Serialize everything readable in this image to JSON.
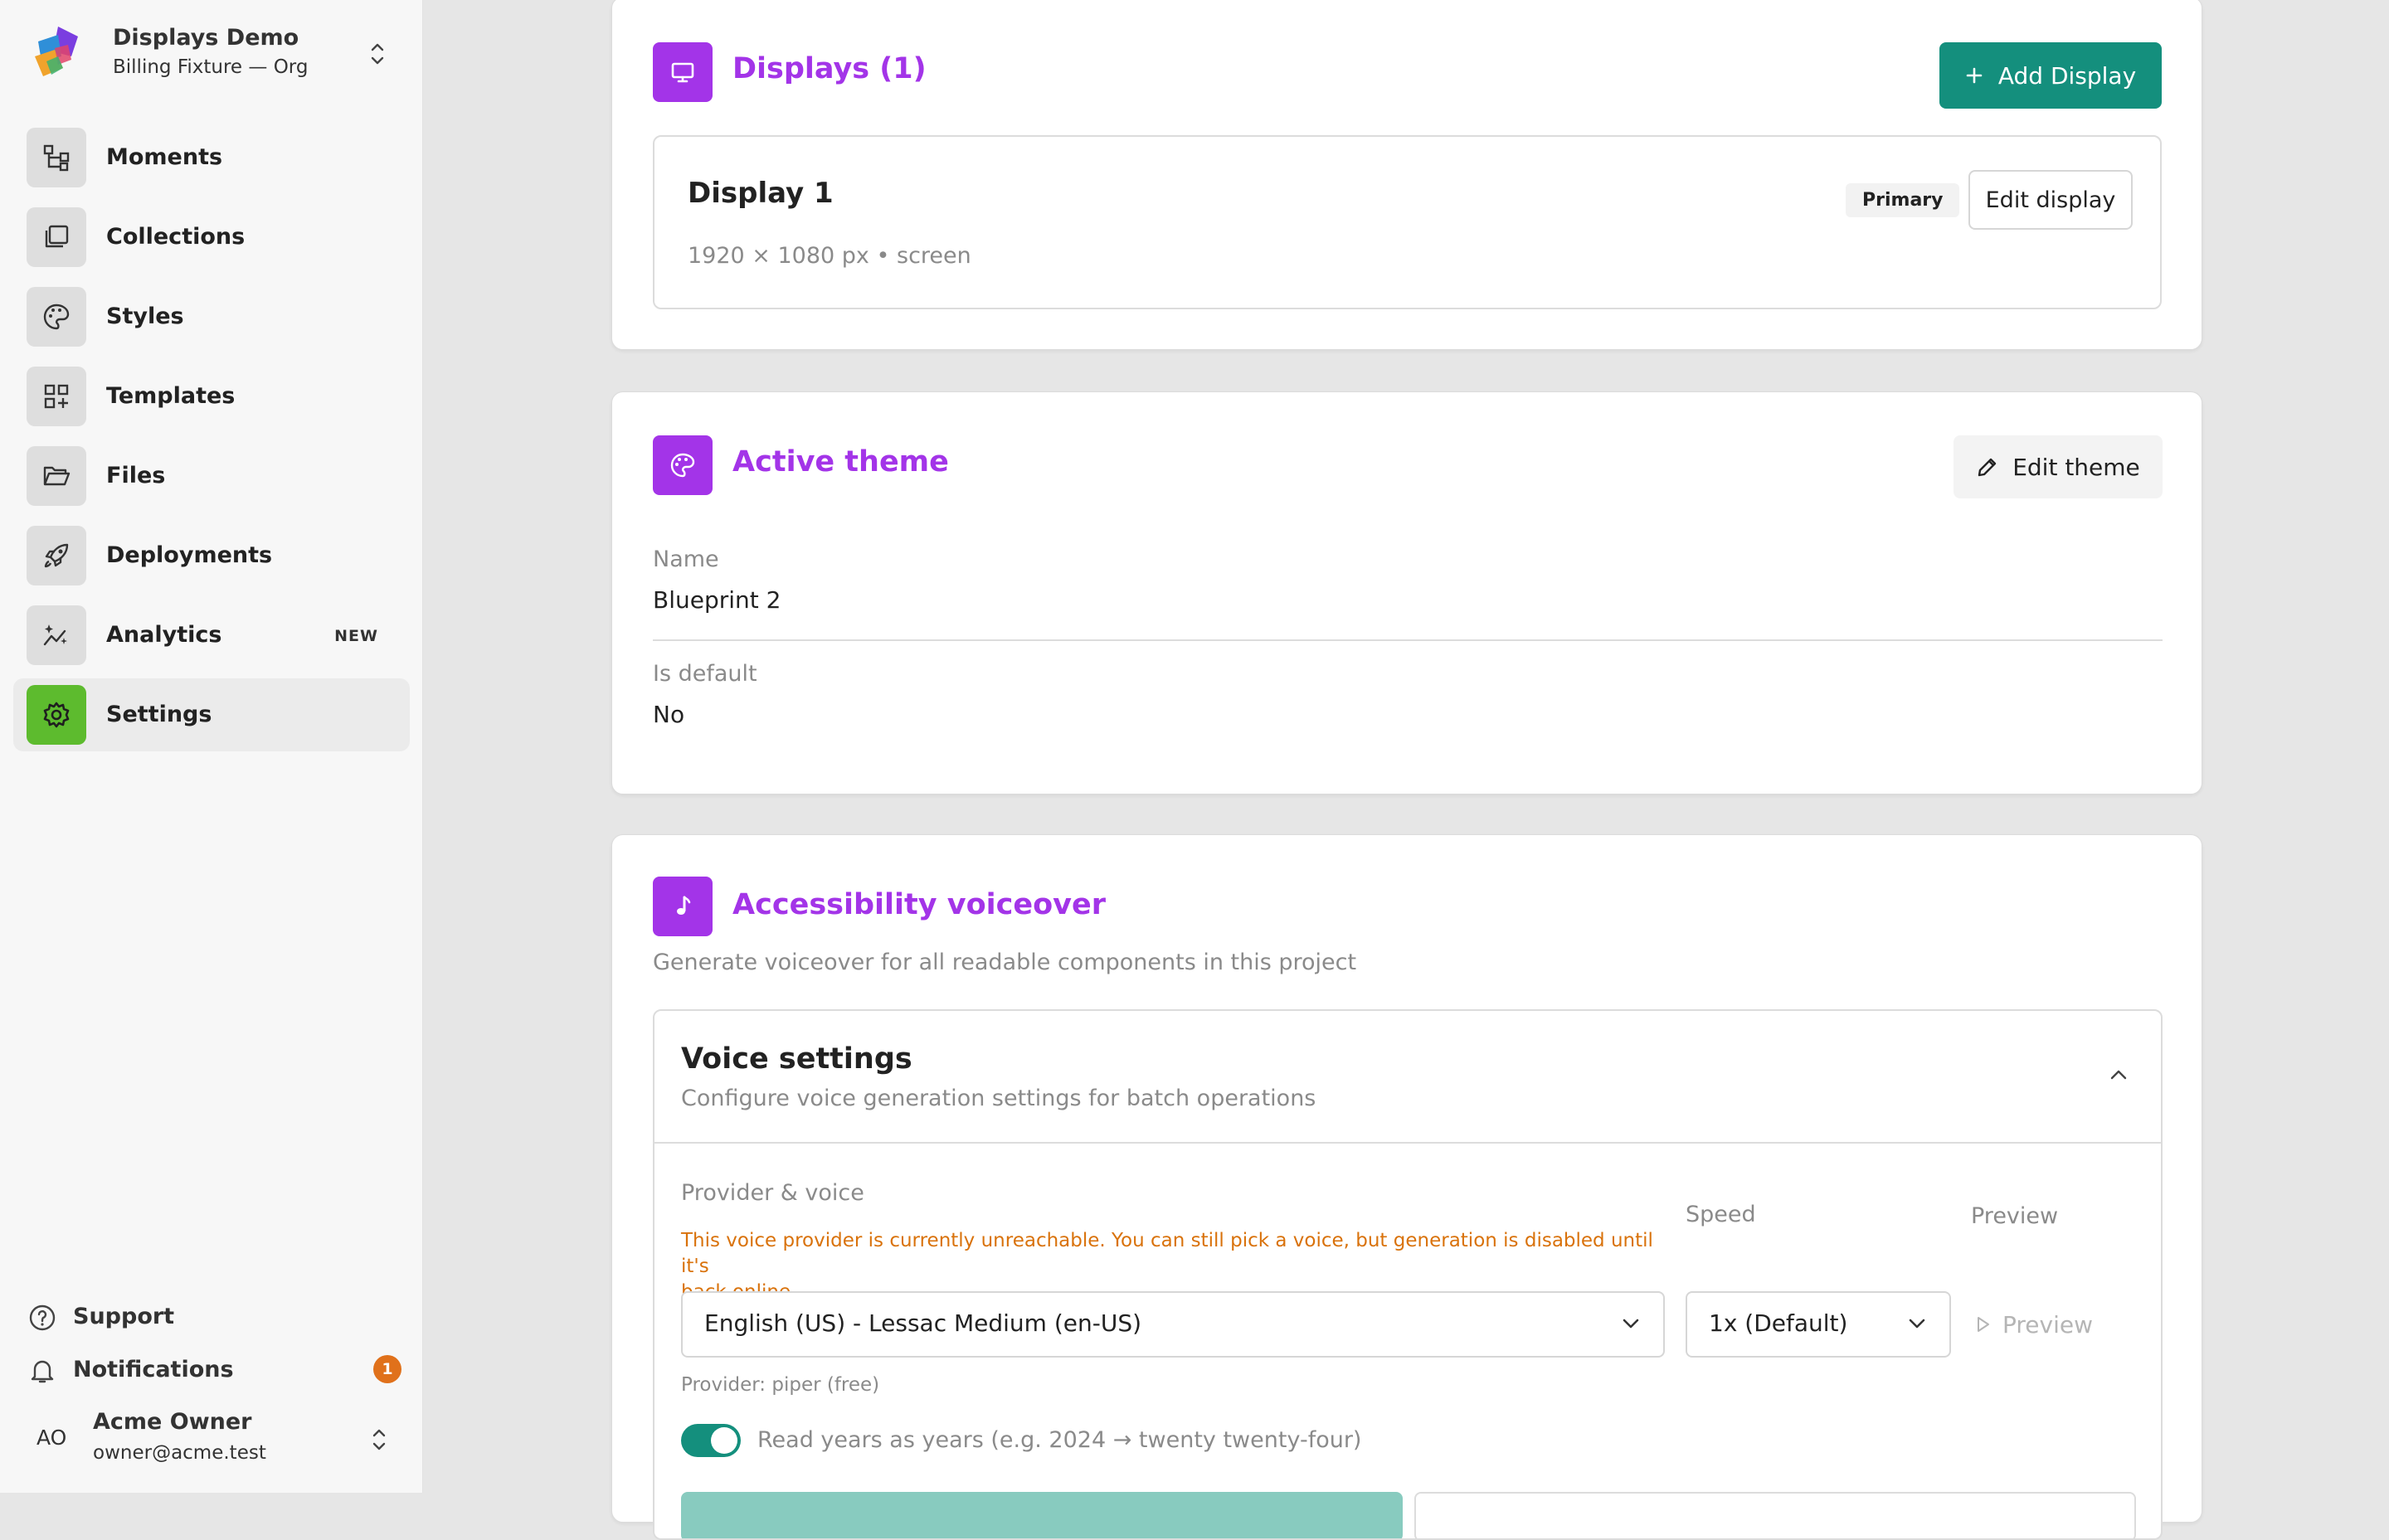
{
  "org": {
    "name": "Displays Demo",
    "subtitle": "Billing Fixture — Org"
  },
  "nav": [
    {
      "label": "Moments",
      "icon": "moments-icon"
    },
    {
      "label": "Collections",
      "icon": "collections-icon"
    },
    {
      "label": "Styles",
      "icon": "palette-icon"
    },
    {
      "label": "Templates",
      "icon": "templates-icon"
    },
    {
      "label": "Files",
      "icon": "folder-icon"
    },
    {
      "label": "Deployments",
      "icon": "rocket-icon"
    },
    {
      "label": "Analytics",
      "icon": "analytics-icon",
      "badge": "NEW"
    },
    {
      "label": "Settings",
      "icon": "gear-icon",
      "active": true
    }
  ],
  "footer": {
    "support": "Support",
    "notifications": "Notifications",
    "notification_count": "1"
  },
  "user": {
    "initials": "AO",
    "name": "Acme Owner",
    "email": "owner@acme.test"
  },
  "displays": {
    "title": "Displays (1)",
    "add_button": "Add Display",
    "item": {
      "name": "Display 1",
      "badge": "Primary",
      "edit_button": "Edit display",
      "meta": "1920 × 1080 px • screen"
    }
  },
  "theme": {
    "title": "Active theme",
    "edit_button": "Edit theme",
    "name_label": "Name",
    "name_value": "Blueprint 2",
    "default_label": "Is default",
    "default_value": "No"
  },
  "voiceover": {
    "title": "Accessibility voiceover",
    "description": "Generate voiceover for all readable components in this project",
    "settings_title": "Voice settings",
    "settings_subtitle": "Configure voice generation settings for batch operations",
    "provider_label": "Provider & voice",
    "warning_line1": "This voice provider is currently unreachable. You can still pick a voice, but generation is disabled until it's",
    "warning_line2": "back online.",
    "voice_value": "English (US) - Lessac Medium (en-US)",
    "provider_note": "Provider: piper (free)",
    "speed_label": "Speed",
    "speed_value": "1x (Default)",
    "preview_label": "Preview",
    "preview_button": "Preview",
    "toggle_label": "Read years as years (e.g. 2024 → twenty twenty-four)",
    "toggle_on": true
  },
  "colors": {
    "accent": "#a334e8",
    "primary": "#148f7d",
    "active_nav": "#5dbb2e",
    "warning": "#d9720b"
  }
}
